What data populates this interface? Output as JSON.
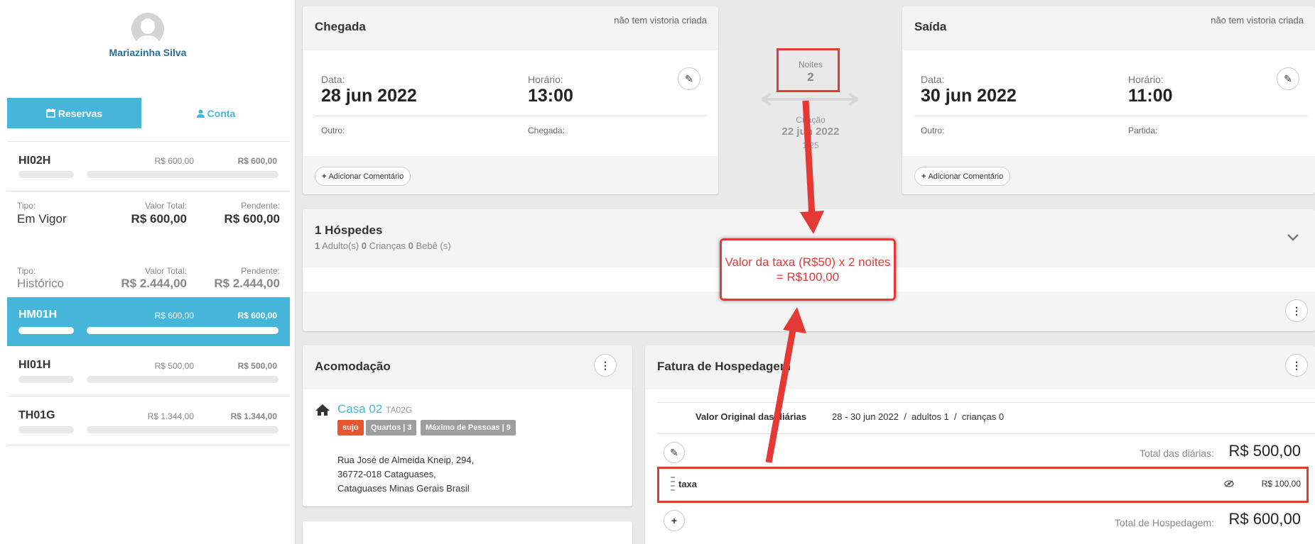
{
  "sidebar": {
    "user_name": "Mariazinha Silva",
    "tabs": {
      "reservas": "Reservas",
      "conta": "Conta"
    },
    "reservations": [
      {
        "code": "HI02H",
        "total": "R$ 600,00",
        "pending": "R$ 600,00",
        "active": false
      },
      {
        "code": "HM01H",
        "total": "R$ 600,00",
        "pending": "R$ 600,00",
        "active": true
      },
      {
        "code": "HI01H",
        "total": "R$ 500,00",
        "pending": "R$ 500,00",
        "active": false
      },
      {
        "code": "TH01G",
        "total": "R$ 1.344,00",
        "pending": "R$ 1.344,00",
        "active": false
      }
    ],
    "summary": [
      {
        "tipo_label": "Tipo:",
        "tipo": "Em Vigor",
        "total_label": "Valor Total:",
        "total": "R$ 600,00",
        "pend_label": "Pendente:",
        "pend": "R$ 600,00"
      },
      {
        "tipo_label": "Tipo:",
        "tipo": "Histórico",
        "total_label": "Valor Total:",
        "total": "R$ 2.444,00",
        "pend_label": "Pendente:",
        "pend": "R$ 2.444,00"
      }
    ]
  },
  "chegada": {
    "title": "Chegada",
    "vistoria": "não tem vistoria criada",
    "data_label": "Data:",
    "data": "28 jun 2022",
    "horario_label": "Horário:",
    "horario": "13:00",
    "outro_label": "Outro:",
    "sub_label": "Chegada:",
    "comment_button": "Adicionar Comentário"
  },
  "saida": {
    "title": "Saída",
    "vistoria": "não tem vistoria criada",
    "data_label": "Data:",
    "data": "30 jun 2022",
    "horario_label": "Horário:",
    "horario": "11:00",
    "outro_label": "Outro:",
    "sub_label": "Partida:",
    "comment_button": "Adicionar Comentário"
  },
  "middle": {
    "noites_label": "Noites",
    "noites": "2",
    "criacao_label": "Criação",
    "criacao_date": "22 jun 2022",
    "criacao_time": "1  25"
  },
  "hospedes": {
    "title": "1 Hóspedes",
    "adults": "1",
    "adults_label": "Adulto(s)",
    "children": "0",
    "children_label": "Crianças",
    "babies": "0",
    "babies_label": "Bebê (s)"
  },
  "acomodacao": {
    "title": "Acomodação",
    "name": "Casa 02",
    "code": "TA02G",
    "badges": [
      {
        "text": "sujo",
        "color": "#e8552f"
      },
      {
        "text": "Quartos | 3",
        "color": "#9e9e9e"
      },
      {
        "text": "Máximo de Pessoas | 9",
        "color": "#9e9e9e"
      }
    ],
    "address": [
      "Rua José de Almeida Kneip, 294,",
      "36772-018 Cataguases,",
      "Cataguases Minas Gerais Brasil"
    ]
  },
  "fatura": {
    "title": "Fatura de Hospedagem",
    "valor_original_label": "Valor Original das diárias",
    "period": "28 - 30 jun 2022  /  adultos 1  /  crianças 0",
    "total_diarias_label": "Total das diárias:",
    "total_diarias": "R$ 500,00",
    "item_name": "taxa",
    "item_value": "R$ 100,00",
    "total_label": "Total de Hospedagem:",
    "total": "R$ 600,00"
  },
  "annotation": {
    "text": "Valor da taxa (R$50) x 2 noites = R$100,00",
    "color": "#e53935"
  }
}
